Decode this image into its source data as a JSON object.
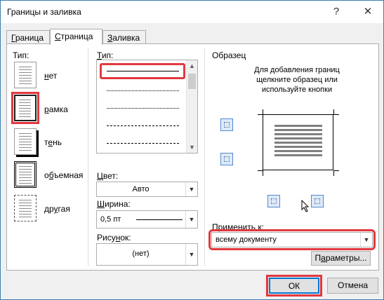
{
  "window": {
    "title": "Границы и заливка",
    "help": "?",
    "close": "✕"
  },
  "tabs": [
    {
      "label": "Граница",
      "underline": "Г",
      "rest": "раница"
    },
    {
      "label": "Страница",
      "underline": "С",
      "rest": "траница"
    },
    {
      "label": "Заливка",
      "underline": "З",
      "rest": "аливка"
    }
  ],
  "settings": {
    "group_label": "Тип:",
    "items": [
      {
        "label_u": "н",
        "label_rest": "ет",
        "icon": "page-none-icon"
      },
      {
        "label_u": "р",
        "label_rest": "амка",
        "icon": "page-box-icon",
        "selected": true
      },
      {
        "label_pre": "т",
        "label_u": "е",
        "label_rest": "нь",
        "icon": "page-shadow-icon"
      },
      {
        "label_pre": "о",
        "label_u": "б",
        "label_rest": "ъемная",
        "icon": "page-3d-icon"
      },
      {
        "label_pre": "др",
        "label_u": "у",
        "label_rest": "гая",
        "icon": "page-custom-icon"
      }
    ]
  },
  "style": {
    "label_u": "Т",
    "label_rest": "ип:",
    "color_label_u": "Ц",
    "color_label_rest": "вет:",
    "color_value": "Авто",
    "width_label_u": "Ш",
    "width_label_rest": "ирина:",
    "width_value": "0,5 пт",
    "art_label_pre": "Рису",
    "art_label_u": "н",
    "art_label_rest": "ок:",
    "art_value": "(нет)"
  },
  "preview": {
    "group_label": "Образец",
    "hint": "Для добавления границ щелкните образец или используйте кнопки",
    "apply_label_pre": "Применит",
    "apply_label_u": "ь",
    "apply_label_rest": " к:",
    "apply_value": "всему документу",
    "options_button_pre": "П",
    "options_button_u": "а",
    "options_button_rest": "раметры..."
  },
  "footer": {
    "ok": "ОК",
    "cancel": "Отмена"
  },
  "colors": {
    "highlight": "#e2383f",
    "accent": "#3c7fb1"
  }
}
